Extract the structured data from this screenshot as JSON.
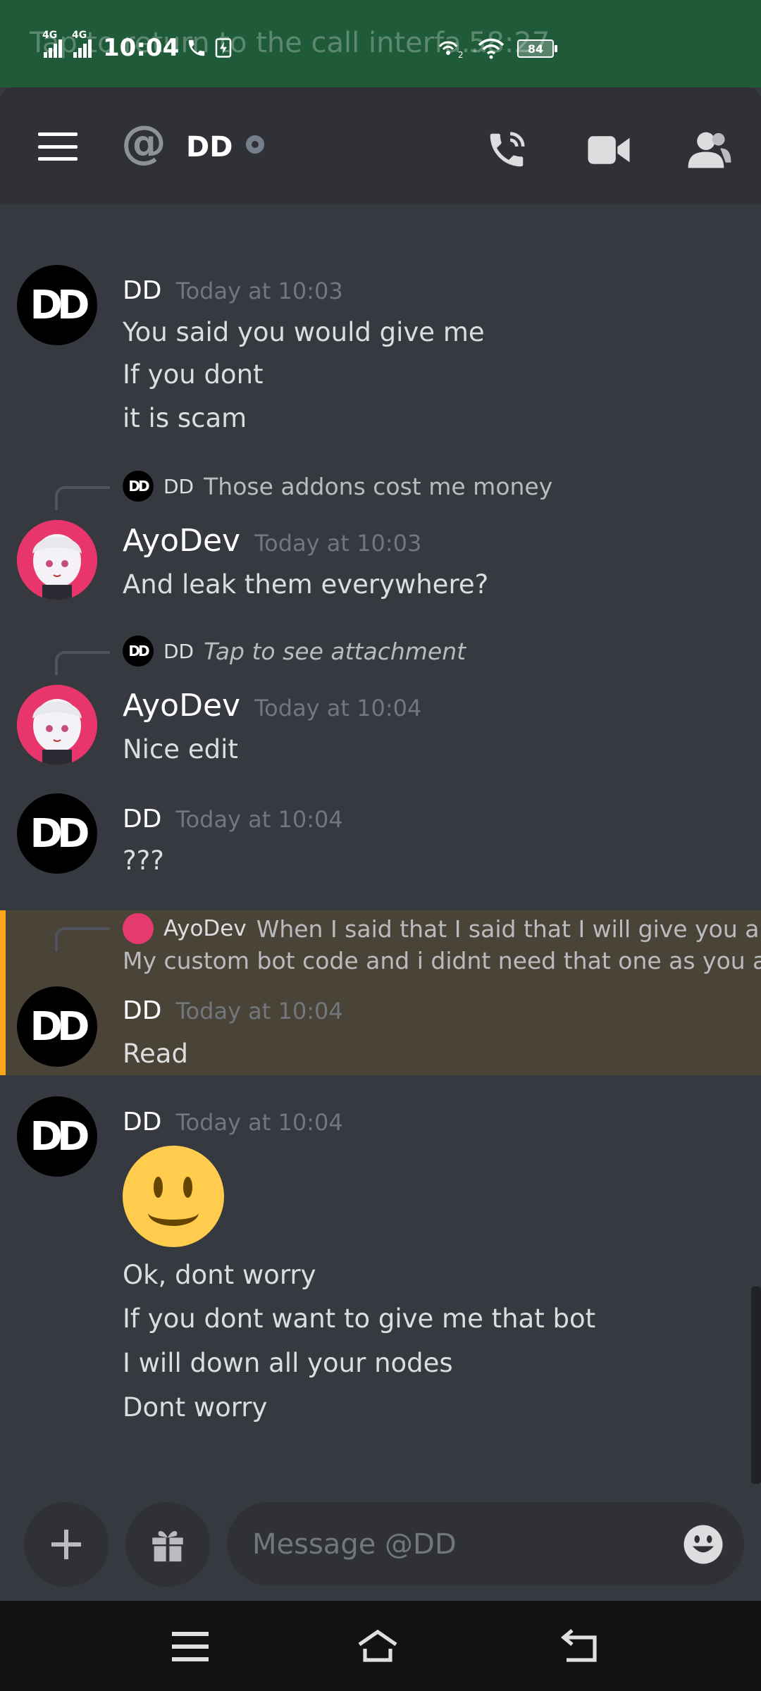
{
  "statusbar": {
    "overlay_text": "Tap to return to the call interfa...",
    "overlay_timer": "58:27",
    "time": "10:04",
    "signal1": "4G",
    "signal2": "4G",
    "battery": "84"
  },
  "header": {
    "title": "DD"
  },
  "messages": [
    {
      "author": "DD",
      "time": "Today at 10:03",
      "lines": [
        "You said you would give me",
        "If you dont",
        "it is scam"
      ]
    },
    {
      "reply_author": "DD",
      "reply_text": "Those addons cost me money",
      "author": "AyoDev",
      "time": "Today at 10:03",
      "lines": [
        "And leak them everywhere?"
      ]
    },
    {
      "reply_author": "DD",
      "reply_text": "Tap to see attachment",
      "author": "AyoDev",
      "time": "Today at 10:04",
      "lines": [
        "Nice edit"
      ]
    },
    {
      "author": "DD",
      "time": "Today at 10:04",
      "lines": [
        "???"
      ]
    },
    {
      "reply_author": "AyoDev",
      "reply_text": "When I said that I said that I will give you a",
      "reply_text2": "My custom bot code and i didnt need that one as you are",
      "author": "DD",
      "time": "Today at 10:04",
      "lines": [
        "Read"
      ]
    },
    {
      "author": "DD",
      "time": "Today at 10:04",
      "emoji": "slightly-smiling-face",
      "lines": [
        "Ok, dont worry",
        "If you dont want to give me that bot",
        "I will down all your nodes",
        "Dont worry"
      ]
    }
  ],
  "avatars": {
    "dd": "DD"
  },
  "composer": {
    "placeholder": "Message @DD"
  },
  "colors": {
    "accent": "#faa61a",
    "header": "#2f3136",
    "background": "#36393f",
    "statusbar": "#1f5a39"
  }
}
